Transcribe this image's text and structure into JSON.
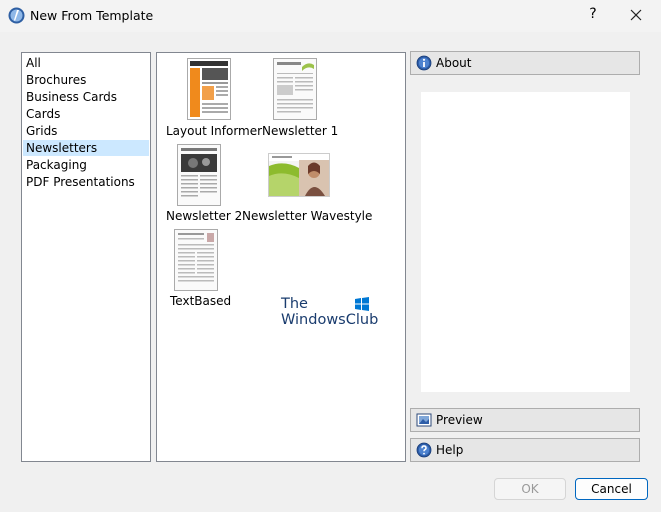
{
  "window": {
    "title": "New From Template",
    "help": "?"
  },
  "categories": [
    "All",
    "Brochures",
    "Business Cards",
    "Cards",
    "Grids",
    "Newsletters",
    "Packaging",
    "PDF Presentations"
  ],
  "selected_category": "Newsletters",
  "templates": [
    "Layout Informer",
    "Newsletter 1",
    "Newsletter 2",
    "Newsletter Wavestyle",
    "TextBased"
  ],
  "side_buttons": {
    "about": "About",
    "preview": "Preview",
    "help": "Help"
  },
  "dialog_buttons": {
    "ok": "OK",
    "cancel": "Cancel"
  },
  "watermark": {
    "line1": "The",
    "line2": "WindowsClub"
  },
  "colors": {
    "selection": "#cce8ff",
    "accent_border": "#0067c0",
    "disabled_text": "#9a9a9a"
  }
}
